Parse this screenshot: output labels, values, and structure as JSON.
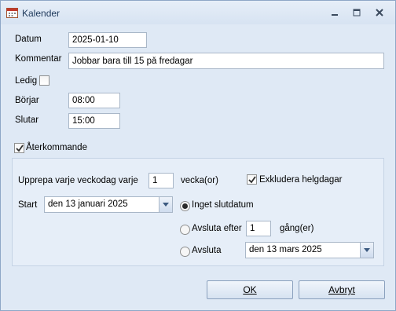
{
  "window": {
    "title": "Kalender"
  },
  "form": {
    "datum_label": "Datum",
    "datum_value": "2025-01-10",
    "kommentar_label": "Kommentar",
    "kommentar_value": "Jobbar bara till 15 på fredagar",
    "ledig_label": "Ledig",
    "ledig_checked": false,
    "borjar_label": "Börjar",
    "borjar_value": "08:00",
    "slutar_label": "Slutar",
    "slutar_value": "15:00",
    "aterkommande_label": "Återkommande",
    "aterkommande_checked": true
  },
  "recurrence": {
    "repeat_label": "Upprepa varje veckodag varje",
    "repeat_value": "1",
    "repeat_unit": "vecka(or)",
    "exclude_label": "Exkludera helgdagar",
    "exclude_checked": true,
    "start_label": "Start",
    "start_value": "den 13 januari 2025",
    "no_end_label": "Inget slutdatum",
    "end_after_label": "Avsluta efter",
    "end_after_value": "1",
    "end_after_unit": "gång(er)",
    "end_on_label": "Avsluta",
    "end_on_value": "den 13 mars 2025",
    "selected_option": "no_end"
  },
  "buttons": {
    "ok": "OK",
    "cancel": "Avbryt"
  },
  "colors": {
    "title_text": "#1e395b",
    "titlebar": "#dbe6f4",
    "body": "#dfe9f5"
  }
}
